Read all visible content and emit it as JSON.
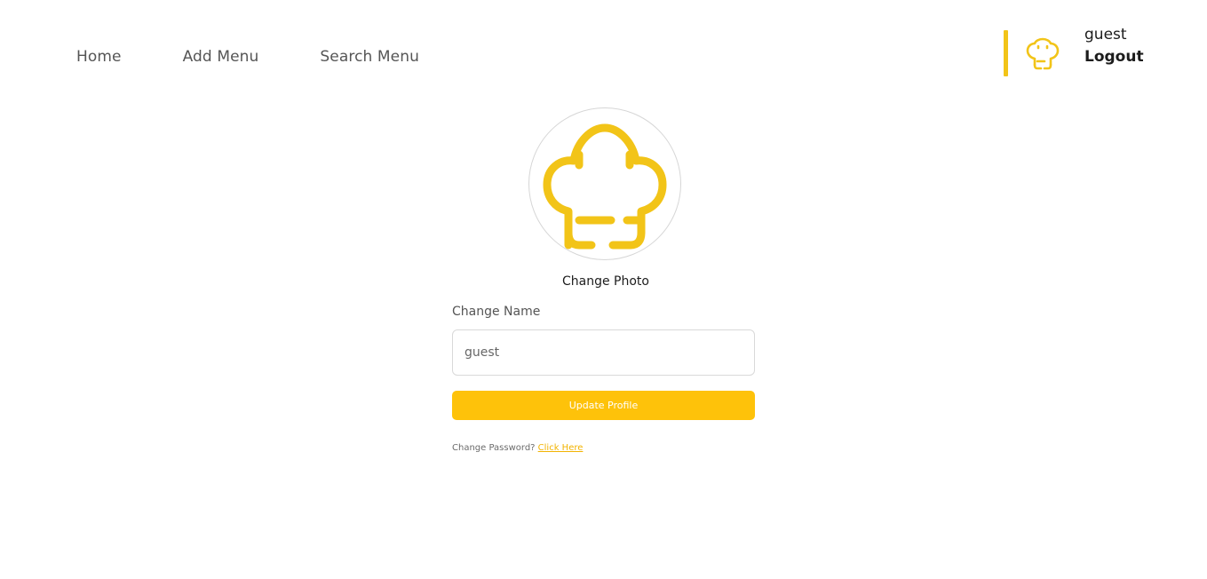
{
  "nav": {
    "links": [
      "Home",
      "Add Menu",
      "Search Menu"
    ]
  },
  "user": {
    "name": "guest",
    "logout_label": "Logout",
    "avatar_icon": "chef-hat-icon"
  },
  "profile": {
    "photo_icon": "chef-hat-icon",
    "change_photo_label": "Change Photo",
    "name_label": "Change Name",
    "name_value": "guest",
    "update_button_label": "Update Profile",
    "password_prompt": "Change Password?",
    "password_link_label": "Click Here"
  },
  "colors": {
    "accent": "#fec20a",
    "icon": "#f2c418",
    "link": "#f2b300"
  }
}
